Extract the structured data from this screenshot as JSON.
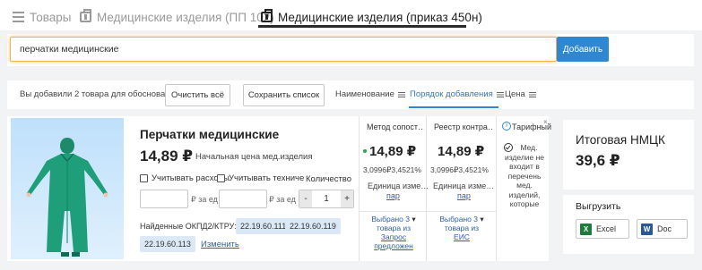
{
  "tabs": [
    {
      "label": "Товары",
      "icon": "list-icon"
    },
    {
      "label": "Медицинские изделия (ПП 102)",
      "icon": "medical-bag-icon"
    },
    {
      "label": "Медицинские изделия (приказ 450н)",
      "icon": "medical-bag-icon"
    }
  ],
  "search": {
    "value": "перчатки медицинские",
    "add_label": "Добавить"
  },
  "toolbar": {
    "summary_text": "Вы добавили 2 товара для обоснования",
    "clear_label": "Очистить всё",
    "save_label": "Сохранить список",
    "sort_name": "Наименование",
    "sort_order": "Порядок добавления",
    "sort_price": "Цена"
  },
  "item": {
    "name": "Перчатки медицинские",
    "price": "14,89 ₽",
    "price_label": "Начальная цена мед.изделия",
    "check_delivery": "Учитывать расходы",
    "check_tech": "Учитывать техниче",
    "quantity_label": "Количество",
    "per_unit_1": "₽ за ед",
    "per_unit_2": "₽ за ед",
    "qty_minus": "-",
    "qty_value": "1",
    "qty_plus": "+",
    "okpd_label": "Найденные ОКПД2/КТРУ:",
    "okpd_codes": [
      "22.19.60.111",
      "22.19.60.119",
      "22.19.60.113"
    ],
    "change_label": "Изменить"
  },
  "columns": [
    {
      "head": "Метод сопост…",
      "price": "14,89 ₽",
      "sub": "3,0996₽3,4521%",
      "unit": "Единица изме…",
      "unit_link": "пар",
      "selected": [
        "Выбрано 3",
        "товара из",
        "Запрос",
        "предложен"
      ]
    },
    {
      "head": "Реестр контра…",
      "price": "14,89 ₽",
      "sub": "3,0996₽3,4521%",
      "unit": "Единица изме…",
      "unit_link": "пар",
      "selected": [
        "Выбрано 3",
        "товара из",
        "ЕИС"
      ]
    },
    {
      "head": "Тарифный",
      "note": [
        "Мед.",
        "изделие не",
        "входит в",
        "перечень",
        "мед.",
        "изделий,",
        "которые"
      ]
    }
  ],
  "summary": {
    "label": "Итоговая НМЦК",
    "value": "39,6 ₽"
  },
  "export": {
    "label": "Выгрузить",
    "excel_label": "Excel",
    "doc_label": "Doc"
  },
  "colors": {
    "accent": "#2f86d1",
    "link": "#2f5fa8",
    "tag_bg": "#dbe8f5",
    "search_border": "#f0b24a",
    "ok_dot": "#2ca54a"
  }
}
